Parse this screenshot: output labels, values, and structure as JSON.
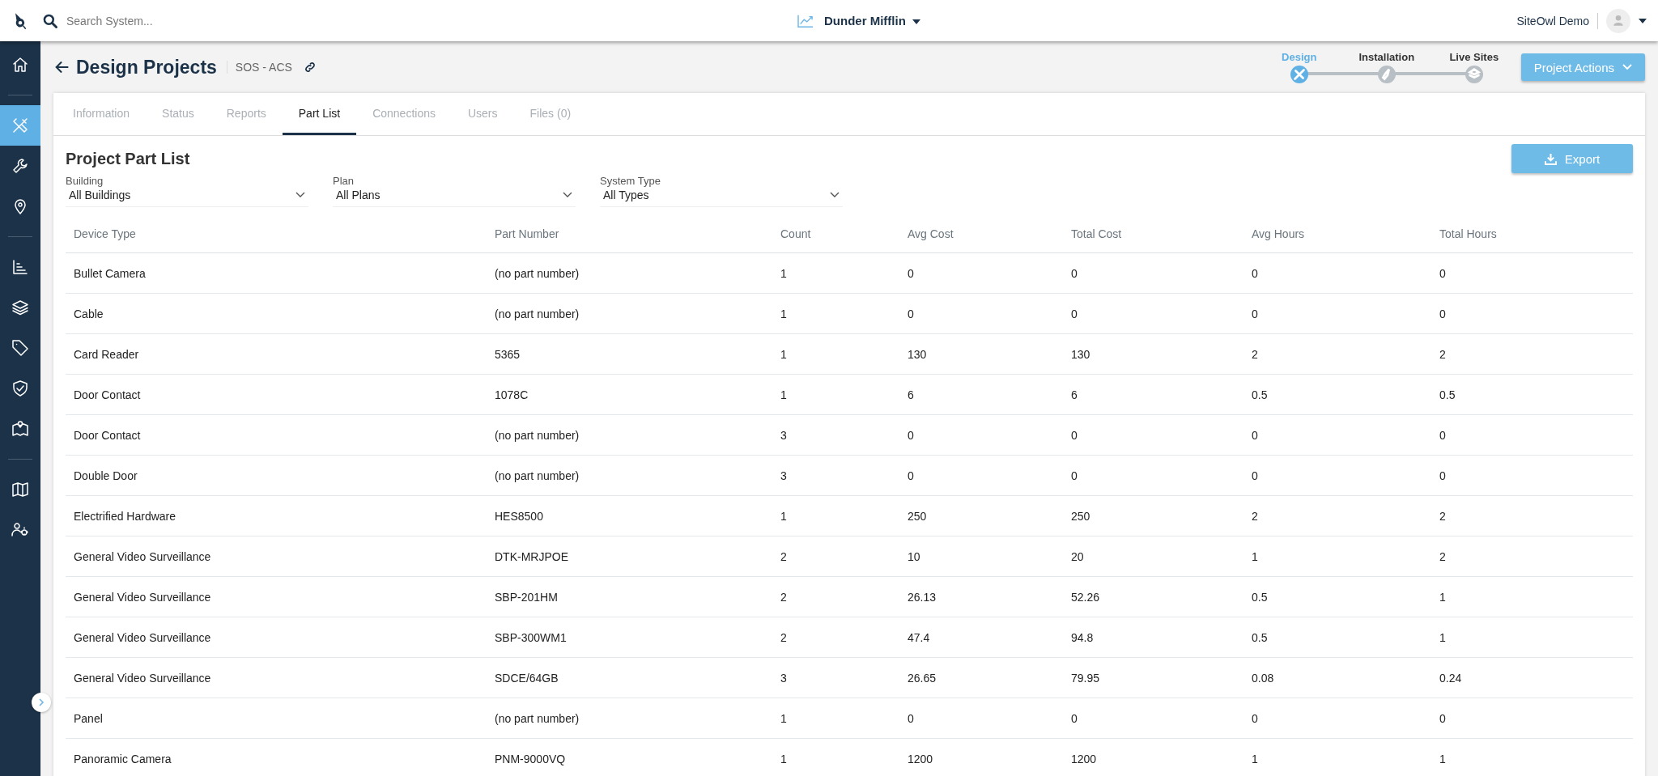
{
  "topbar": {
    "search": {
      "placeholder": "Search System..."
    },
    "company": "Dunder Mifflin",
    "user": "SiteOwl Demo"
  },
  "sidebar": {
    "items": [
      {
        "kind": "home",
        "selected": false
      },
      {
        "kind": "divider"
      },
      {
        "kind": "design",
        "selected": true
      },
      {
        "kind": "wrench",
        "selected": false
      },
      {
        "kind": "pin",
        "selected": false
      },
      {
        "kind": "divider"
      },
      {
        "kind": "chart",
        "selected": false
      },
      {
        "kind": "layers",
        "selected": false
      },
      {
        "kind": "tag",
        "selected": false
      },
      {
        "kind": "shield",
        "selected": false
      },
      {
        "kind": "mappin",
        "selected": false
      },
      {
        "kind": "divider"
      },
      {
        "kind": "map",
        "selected": false
      },
      {
        "kind": "usersettings",
        "selected": false
      }
    ]
  },
  "header": {
    "title": "Design Projects",
    "subtitle": "SOS - ACS"
  },
  "stepper": [
    {
      "label": "Design",
      "selected": true,
      "kind": "design"
    },
    {
      "label": "Installation",
      "selected": false,
      "kind": "wrench"
    },
    {
      "label": "Live Sites",
      "selected": false,
      "kind": "layers"
    }
  ],
  "project_actions": "Project Actions",
  "tabs": [
    {
      "label": "Information",
      "selected": false
    },
    {
      "label": "Status",
      "selected": false
    },
    {
      "label": "Reports",
      "selected": false
    },
    {
      "label": "Part List",
      "selected": true
    },
    {
      "label": "Connections",
      "selected": false
    },
    {
      "label": "Users",
      "selected": false
    },
    {
      "label": "Files (0)",
      "selected": false
    }
  ],
  "section_title": "Project Part List",
  "export": "Export",
  "filters": [
    {
      "label": "Building",
      "value": "All Buildings"
    },
    {
      "label": "Plan",
      "value": "All Plans"
    },
    {
      "label": "System Type",
      "value": "All Types"
    }
  ],
  "table": {
    "columns": [
      "Device Type",
      "Part Number",
      "Count",
      "Avg Cost",
      "Total Cost",
      "Avg Hours",
      "Total Hours"
    ],
    "rows": [
      [
        "Bullet Camera",
        "(no part number)",
        "1",
        "0",
        "0",
        "0",
        "0"
      ],
      [
        "Cable",
        "(no part number)",
        "1",
        "0",
        "0",
        "0",
        "0"
      ],
      [
        "Card Reader",
        "5365",
        "1",
        "130",
        "130",
        "2",
        "2"
      ],
      [
        "Door Contact",
        "1078C",
        "1",
        "6",
        "6",
        "0.5",
        "0.5"
      ],
      [
        "Door Contact",
        "(no part number)",
        "3",
        "0",
        "0",
        "0",
        "0"
      ],
      [
        "Double Door",
        "(no part number)",
        "3",
        "0",
        "0",
        "0",
        "0"
      ],
      [
        "Electrified Hardware",
        "HES8500",
        "1",
        "250",
        "250",
        "2",
        "2"
      ],
      [
        "General Video Surveillance",
        "DTK-MRJPOE",
        "2",
        "10",
        "20",
        "1",
        "2"
      ],
      [
        "General Video Surveillance",
        "SBP-201HM",
        "2",
        "26.13",
        "52.26",
        "0.5",
        "1"
      ],
      [
        "General Video Surveillance",
        "SBP-300WM1",
        "2",
        "47.4",
        "94.8",
        "0.5",
        "1"
      ],
      [
        "General Video Surveillance",
        "SDCE/64GB",
        "3",
        "26.65",
        "79.95",
        "0.08",
        "0.24"
      ],
      [
        "Panel",
        "(no part number)",
        "1",
        "0",
        "0",
        "0",
        "0"
      ],
      [
        "Panoramic Camera",
        "PNM-9000VQ",
        "1",
        "1200",
        "1200",
        "1",
        "1"
      ]
    ]
  }
}
